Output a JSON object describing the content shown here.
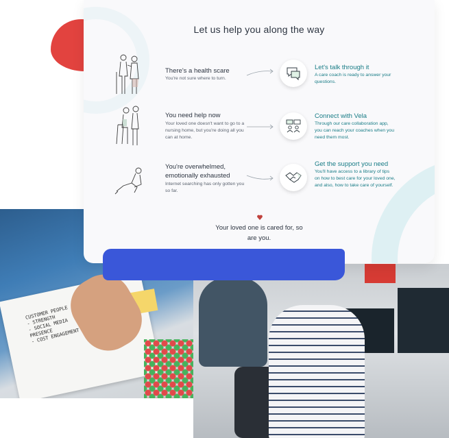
{
  "card": {
    "title": "Let us help you along the way",
    "rows": [
      {
        "question_title": "There's a health scare",
        "question_text": "You're not sure where to turn.",
        "answer_title": "Let's talk through it",
        "answer_text": "A care coach is ready to answer your questions.",
        "illustration": "elderly-couple-illustration",
        "icon": "chat-bubbles-icon"
      },
      {
        "question_title": "You need help now",
        "question_text": "Your loved one doesn't want to go to a nursing home, but you're doing all you can at home.",
        "answer_title": "Connect with Vela",
        "answer_text": "Through our care collaboration app, you can reach your coaches when you need them most.",
        "illustration": "caregiver-with-walker-illustration",
        "icon": "video-call-icon"
      },
      {
        "question_title": "You're overwhelmed, emotionally exhausted",
        "question_text": "Internet searching has only gotten you so far.",
        "answer_title": "Get the support you need",
        "answer_text": "You'll have access to a library of tips on how to best care for your loved one, and also, how to take care of yourself.",
        "illustration": "overwhelmed-person-illustration",
        "icon": "handshake-icon"
      }
    ],
    "closing": "Your loved one is cared for, so are you."
  },
  "photos": {
    "left_note_text": "CUSTOMER PEOPLE\n- STRENGTH\n- SOCIAL MEDIA\n  PRESENCE\n- COST ENGAGEMENT"
  },
  "colors": {
    "accent_teal": "#187c86",
    "text_dark": "#2c3440",
    "blob_red": "#e2433f",
    "strip_blue": "#3a57d9"
  }
}
